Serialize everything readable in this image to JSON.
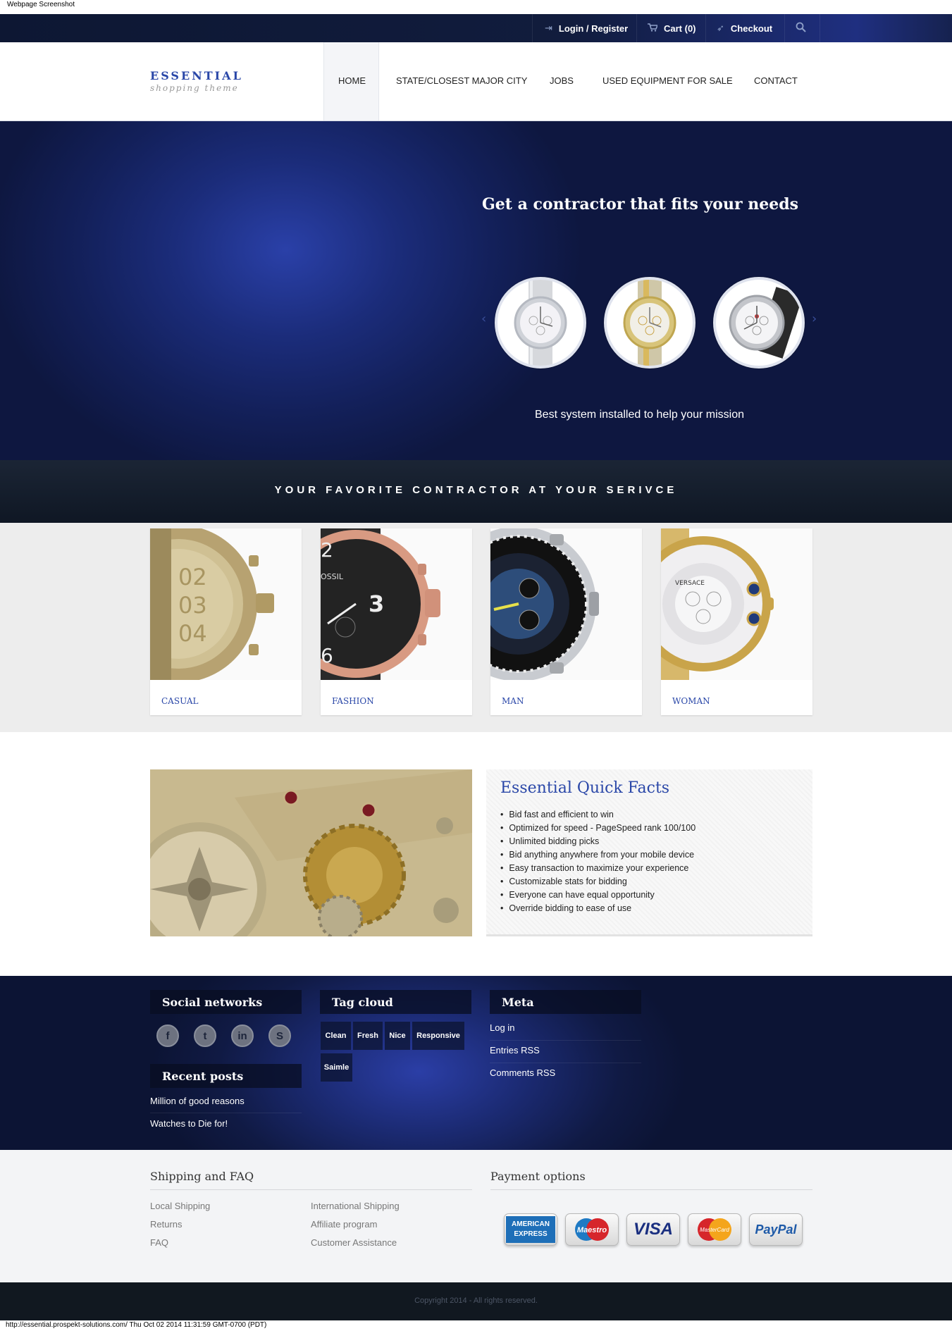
{
  "window": {
    "caption": "Webpage Screenshot",
    "footer_caption": "http://essential.prospekt-solutions.com/ Thu Oct 02 2014 11:31:59 GMT-0700 (PDT)"
  },
  "topbar": {
    "login_label": "Login / Register",
    "cart_label": "Cart (0)",
    "checkout_label": "Checkout",
    "icons": {
      "login": "login-icon",
      "cart": "cart-icon",
      "checkout": "rocket-icon",
      "search": "search-icon"
    }
  },
  "header": {
    "logo_name": "ESSENTIAL",
    "logo_tag": "shopping theme",
    "nav": [
      {
        "label": "HOME",
        "active": true
      },
      {
        "label": "STATE/CLOSEST MAJOR CITY"
      },
      {
        "label": "JOBS"
      },
      {
        "label": "USED EQUIPMENT FOR SALE"
      },
      {
        "label": "CONTACT"
      }
    ]
  },
  "hero": {
    "title": "Get a contractor that fits your needs",
    "subtitle": "Best system installed to help your mission",
    "slides": [
      "silver-watch",
      "gold-watch",
      "leather-watch"
    ],
    "prev_arrow": "‹",
    "next_arrow": "›"
  },
  "banner": {
    "text": "YOUR FAVORITE CONTRACTOR AT YOUR SERIVCE"
  },
  "categories": [
    {
      "label": "CASUAL",
      "image": "gold-chronograph"
    },
    {
      "label": "FASHION",
      "image": "black-rose-gold-watch"
    },
    {
      "label": "MAN",
      "image": "sport-diver-watch"
    },
    {
      "label": "WOMAN",
      "image": "versace-watch"
    }
  ],
  "quick_facts": {
    "title": "Essential Quick Facts",
    "items": [
      "Bid fast and efficient to win",
      "Optimized for speed - PageSpeed rank 100/100",
      "Unlimited bidding picks",
      "Bid anything anywhere from your mobile device",
      "Easy transaction to maximize your experience",
      "Customizable stats for bidding",
      "Everyone can have equal opportunity",
      "Override bidding to ease of use"
    ]
  },
  "footer_widgets": {
    "social_title": "Social networks",
    "social": [
      {
        "name": "facebook-icon",
        "glyph": "f"
      },
      {
        "name": "twitter-icon",
        "glyph": "t"
      },
      {
        "name": "linkedin-icon",
        "glyph": "in"
      },
      {
        "name": "skype-icon",
        "glyph": "S"
      }
    ],
    "recent_title": "Recent posts",
    "recent": [
      "Million of good reasons",
      "Watches to Die for!"
    ],
    "tags_title": "Tag cloud",
    "tags": [
      "Clean",
      "Fresh",
      "Nice",
      "Responsive",
      "Saimle"
    ],
    "meta_title": "Meta",
    "meta": [
      "Log in",
      "Entries RSS",
      "Comments RSS"
    ]
  },
  "shipping": {
    "title": "Shipping and FAQ",
    "col1": [
      "Local Shipping",
      "Returns",
      "FAQ"
    ],
    "col2": [
      "International Shipping",
      "Affiliate program",
      "Customer Assistance"
    ],
    "payment_title": "Payment options",
    "cards": [
      {
        "name": "amex-card",
        "line1": "AMERICAN",
        "line2": "EXPRESS"
      },
      {
        "name": "maestro-card",
        "label": "Maestro"
      },
      {
        "name": "visa-card",
        "label": "VISA"
      },
      {
        "name": "mastercard-card",
        "label": "MasterCard"
      },
      {
        "name": "paypal-card",
        "label": "PayPal"
      }
    ]
  },
  "copyright": "Copyright 2014 - All rights reserved."
}
